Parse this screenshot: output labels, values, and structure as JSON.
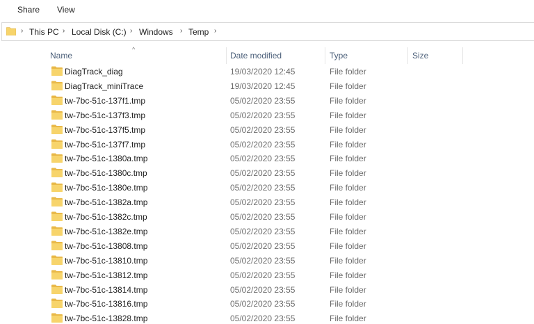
{
  "ribbon": {
    "tabs": [
      "Share",
      "View"
    ]
  },
  "address": {
    "crumbs": [
      "This PC",
      "Local Disk (C:)",
      "Windows",
      "Temp"
    ],
    "separator": "›"
  },
  "columns": {
    "name": "Name",
    "date_modified": "Date modified",
    "type": "Type",
    "size": "Size",
    "sort_indicator": "^"
  },
  "colors": {
    "folder_fill": "#f7d46b",
    "folder_tab": "#e9b949",
    "header_text": "#4c607a"
  },
  "files": [
    {
      "name": "DiagTrack_diag",
      "date": "19/03/2020 12:45",
      "type": "File folder",
      "size": ""
    },
    {
      "name": "DiagTrack_miniTrace",
      "date": "19/03/2020 12:45",
      "type": "File folder",
      "size": ""
    },
    {
      "name": "tw-7bc-51c-137f1.tmp",
      "date": "05/02/2020 23:55",
      "type": "File folder",
      "size": ""
    },
    {
      "name": "tw-7bc-51c-137f3.tmp",
      "date": "05/02/2020 23:55",
      "type": "File folder",
      "size": ""
    },
    {
      "name": "tw-7bc-51c-137f5.tmp",
      "date": "05/02/2020 23:55",
      "type": "File folder",
      "size": ""
    },
    {
      "name": "tw-7bc-51c-137f7.tmp",
      "date": "05/02/2020 23:55",
      "type": "File folder",
      "size": ""
    },
    {
      "name": "tw-7bc-51c-1380a.tmp",
      "date": "05/02/2020 23:55",
      "type": "File folder",
      "size": ""
    },
    {
      "name": "tw-7bc-51c-1380c.tmp",
      "date": "05/02/2020 23:55",
      "type": "File folder",
      "size": ""
    },
    {
      "name": "tw-7bc-51c-1380e.tmp",
      "date": "05/02/2020 23:55",
      "type": "File folder",
      "size": ""
    },
    {
      "name": "tw-7bc-51c-1382a.tmp",
      "date": "05/02/2020 23:55",
      "type": "File folder",
      "size": ""
    },
    {
      "name": "tw-7bc-51c-1382c.tmp",
      "date": "05/02/2020 23:55",
      "type": "File folder",
      "size": ""
    },
    {
      "name": "tw-7bc-51c-1382e.tmp",
      "date": "05/02/2020 23:55",
      "type": "File folder",
      "size": ""
    },
    {
      "name": "tw-7bc-51c-13808.tmp",
      "date": "05/02/2020 23:55",
      "type": "File folder",
      "size": ""
    },
    {
      "name": "tw-7bc-51c-13810.tmp",
      "date": "05/02/2020 23:55",
      "type": "File folder",
      "size": ""
    },
    {
      "name": "tw-7bc-51c-13812.tmp",
      "date": "05/02/2020 23:55",
      "type": "File folder",
      "size": ""
    },
    {
      "name": "tw-7bc-51c-13814.tmp",
      "date": "05/02/2020 23:55",
      "type": "File folder",
      "size": ""
    },
    {
      "name": "tw-7bc-51c-13816.tmp",
      "date": "05/02/2020 23:55",
      "type": "File folder",
      "size": ""
    },
    {
      "name": "tw-7bc-51c-13828.tmp",
      "date": "05/02/2020 23:55",
      "type": "File folder",
      "size": ""
    }
  ]
}
